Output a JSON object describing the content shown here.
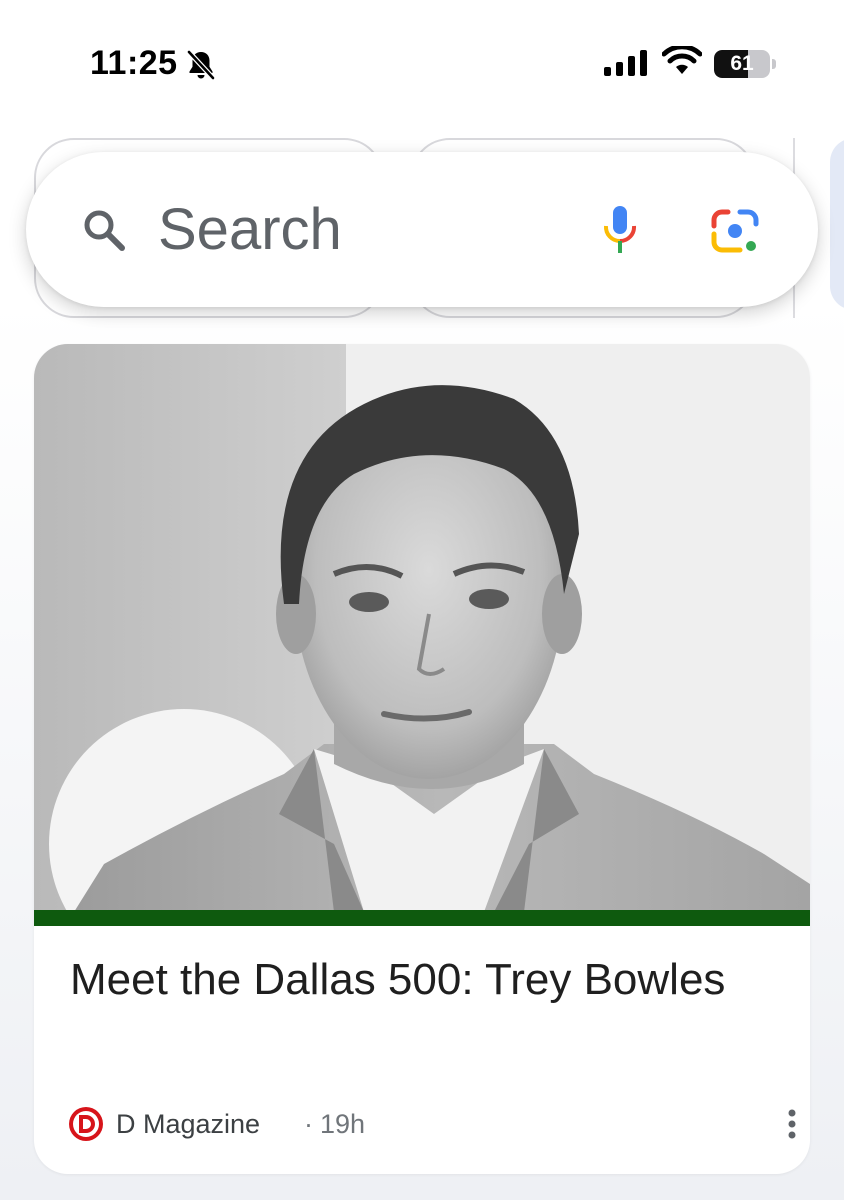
{
  "status_bar": {
    "time": "11:25",
    "battery_level": "61",
    "battery_fraction": 0.61,
    "icons": [
      "bell-off-icon",
      "cellular-signal-icon",
      "wifi-icon",
      "battery-icon"
    ]
  },
  "search": {
    "placeholder": "Search",
    "icons": [
      "search-icon",
      "mic-icon",
      "google-lens-icon"
    ]
  },
  "card": {
    "title": "Meet the Dallas 500: Trey Bowles",
    "source": "D Magazine",
    "separator": "·",
    "time": "19h",
    "source_logo_letter": "D",
    "accent_color": "#0e5a0e"
  },
  "colors": {
    "google_blue": "#4285F4",
    "google_red": "#EA4335",
    "google_yellow": "#FBBC05",
    "google_green": "#34A853",
    "d_magazine_red": "#d7141a"
  }
}
